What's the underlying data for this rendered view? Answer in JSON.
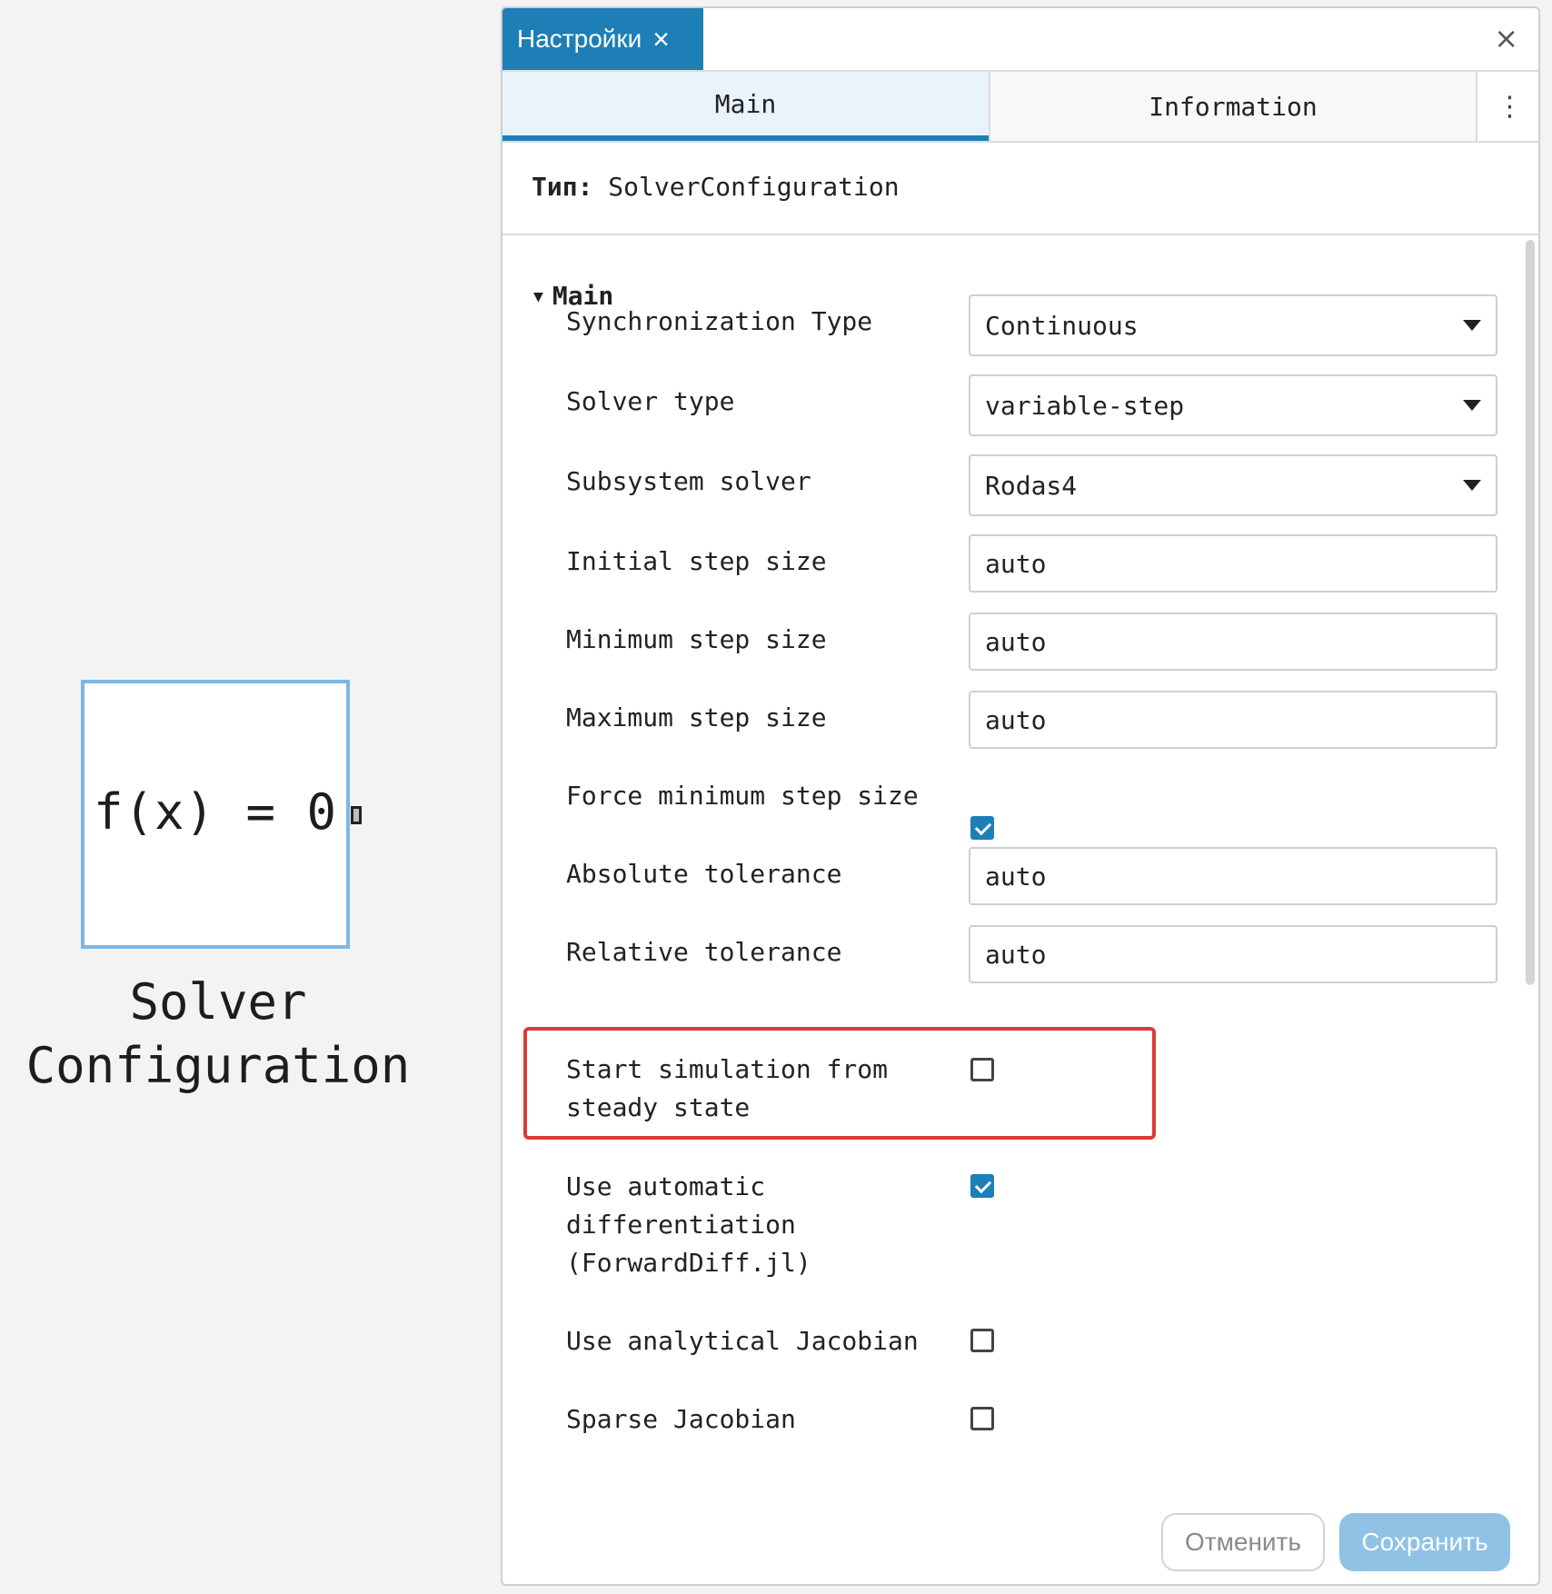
{
  "block": {
    "formula": "f(x) = 0",
    "caption_line1": "Solver",
    "caption_line2": "Configuration"
  },
  "dialog": {
    "title_tab": "Настройки",
    "title_tab_close": "×",
    "close": "×",
    "tabs": [
      {
        "label": "Main",
        "active": true
      },
      {
        "label": "Information",
        "active": false
      }
    ],
    "more": "⋮",
    "type_label": "Тип:",
    "type_value": "SolverConfiguration",
    "section": {
      "toggle": "▼",
      "title": "Main"
    },
    "params": {
      "sync_type": {
        "label": "Synchronization Type",
        "value": "Continuous"
      },
      "solver_type": {
        "label": "Solver type",
        "value": "variable-step"
      },
      "subsystem_solver": {
        "label": "Subsystem solver",
        "value": "Rodas4"
      },
      "initial_step": {
        "label": "Initial step size",
        "value": "auto"
      },
      "min_step": {
        "label": "Minimum step size",
        "value": "auto"
      },
      "max_step": {
        "label": "Maximum step size",
        "value": "auto"
      },
      "force_min_step": {
        "label": "Force minimum step size",
        "checked": true
      },
      "abs_tol": {
        "label": "Absolute tolerance",
        "value": "auto"
      },
      "rel_tol": {
        "label": "Relative tolerance",
        "value": "auto"
      },
      "steady_state": {
        "label_line1": "Start simulation from",
        "label_line2": "steady state",
        "checked": false
      },
      "auto_diff": {
        "label_line1": "Use automatic",
        "label_line2": "differentiation",
        "label_line3": "(ForwardDiff.jl)",
        "checked": true
      },
      "analytical_jac": {
        "label": "Use analytical Jacobian",
        "checked": false
      },
      "sparse_jac": {
        "label": "Sparse Jacobian",
        "checked": false
      }
    },
    "buttons": {
      "cancel": "Отменить",
      "save": "Сохранить"
    },
    "colors": {
      "accent": "#1e7eb6",
      "highlight": "#dc3b35",
      "save_disabled": "#8fc2e5"
    }
  }
}
